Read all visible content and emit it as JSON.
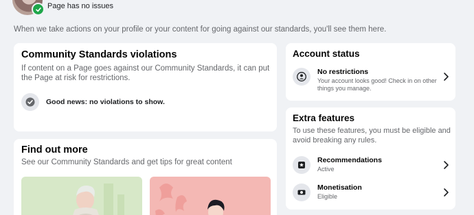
{
  "header": {
    "page_status": "Page has no issues",
    "intro": "When we take actions on your profile or your content for going against our standards, you'll see them here."
  },
  "community_standards": {
    "title": "Community Standards violations",
    "subtitle": "If content on a Page goes against our Community Standards, it can put the Page at risk for restrictions.",
    "good_news": "Good news: no violations to show."
  },
  "find_out_more": {
    "title": "Find out more",
    "subtitle": "See our Community Standards and get tips for great content"
  },
  "account_status": {
    "title": "Account status",
    "row_title": "No restrictions",
    "row_sub": "Your account looks good! Check in on other things you manage."
  },
  "extra_features": {
    "title": "Extra features",
    "subtitle": "To use these features, you must be eligible and avoid breaking any rules.",
    "items": [
      {
        "label": "Recommendations",
        "status": "Active"
      },
      {
        "label": "Monetisation",
        "status": "Eligible"
      }
    ]
  },
  "colors": {
    "success": "#1fa64a",
    "muted": "#65676b",
    "background": "#f0f2f5"
  }
}
